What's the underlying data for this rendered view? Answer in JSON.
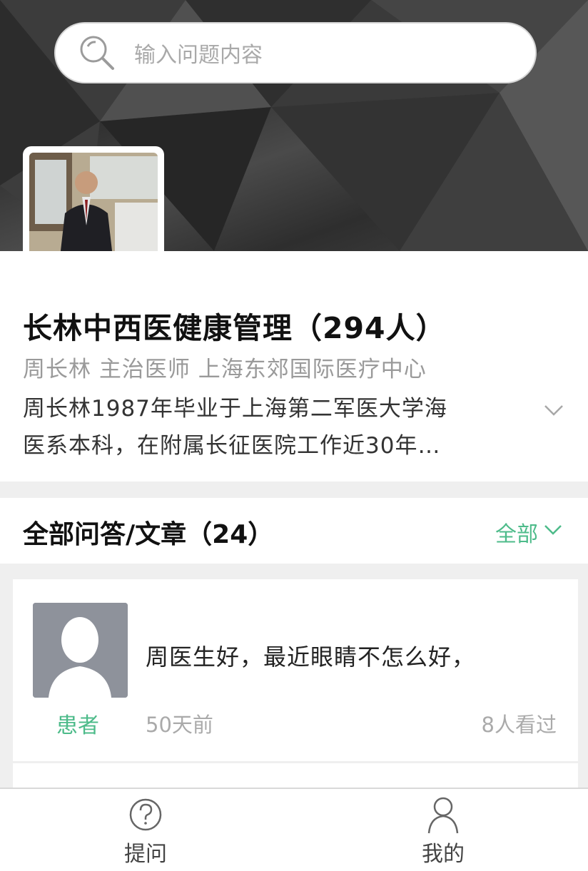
{
  "search": {
    "placeholder": "输入问题内容",
    "icon": "search-icon"
  },
  "profile": {
    "title": "长林中西医健康管理（294人）",
    "subtitle": "周长林 主治医师 上海东郊国际医疗中心",
    "bio_line1": "周长林1987年毕业于上海第二军医大学海",
    "bio_line2": "医系本科，在附属长征医院工作近30年…",
    "expand_icon": "chevron-down-icon"
  },
  "section": {
    "heading": "全部问答/文章（24）",
    "filter_label": "全部",
    "accent_color": "#4dbb8a"
  },
  "posts": [
    {
      "role": "患者",
      "question": "周医生好，最近眼睛不怎么好，",
      "time": "50天前",
      "views": "8人看过"
    }
  ],
  "tabbar": {
    "ask_label": "提问",
    "ask_icon": "question-circle-icon",
    "mine_label": "我的",
    "mine_icon": "user-icon"
  }
}
